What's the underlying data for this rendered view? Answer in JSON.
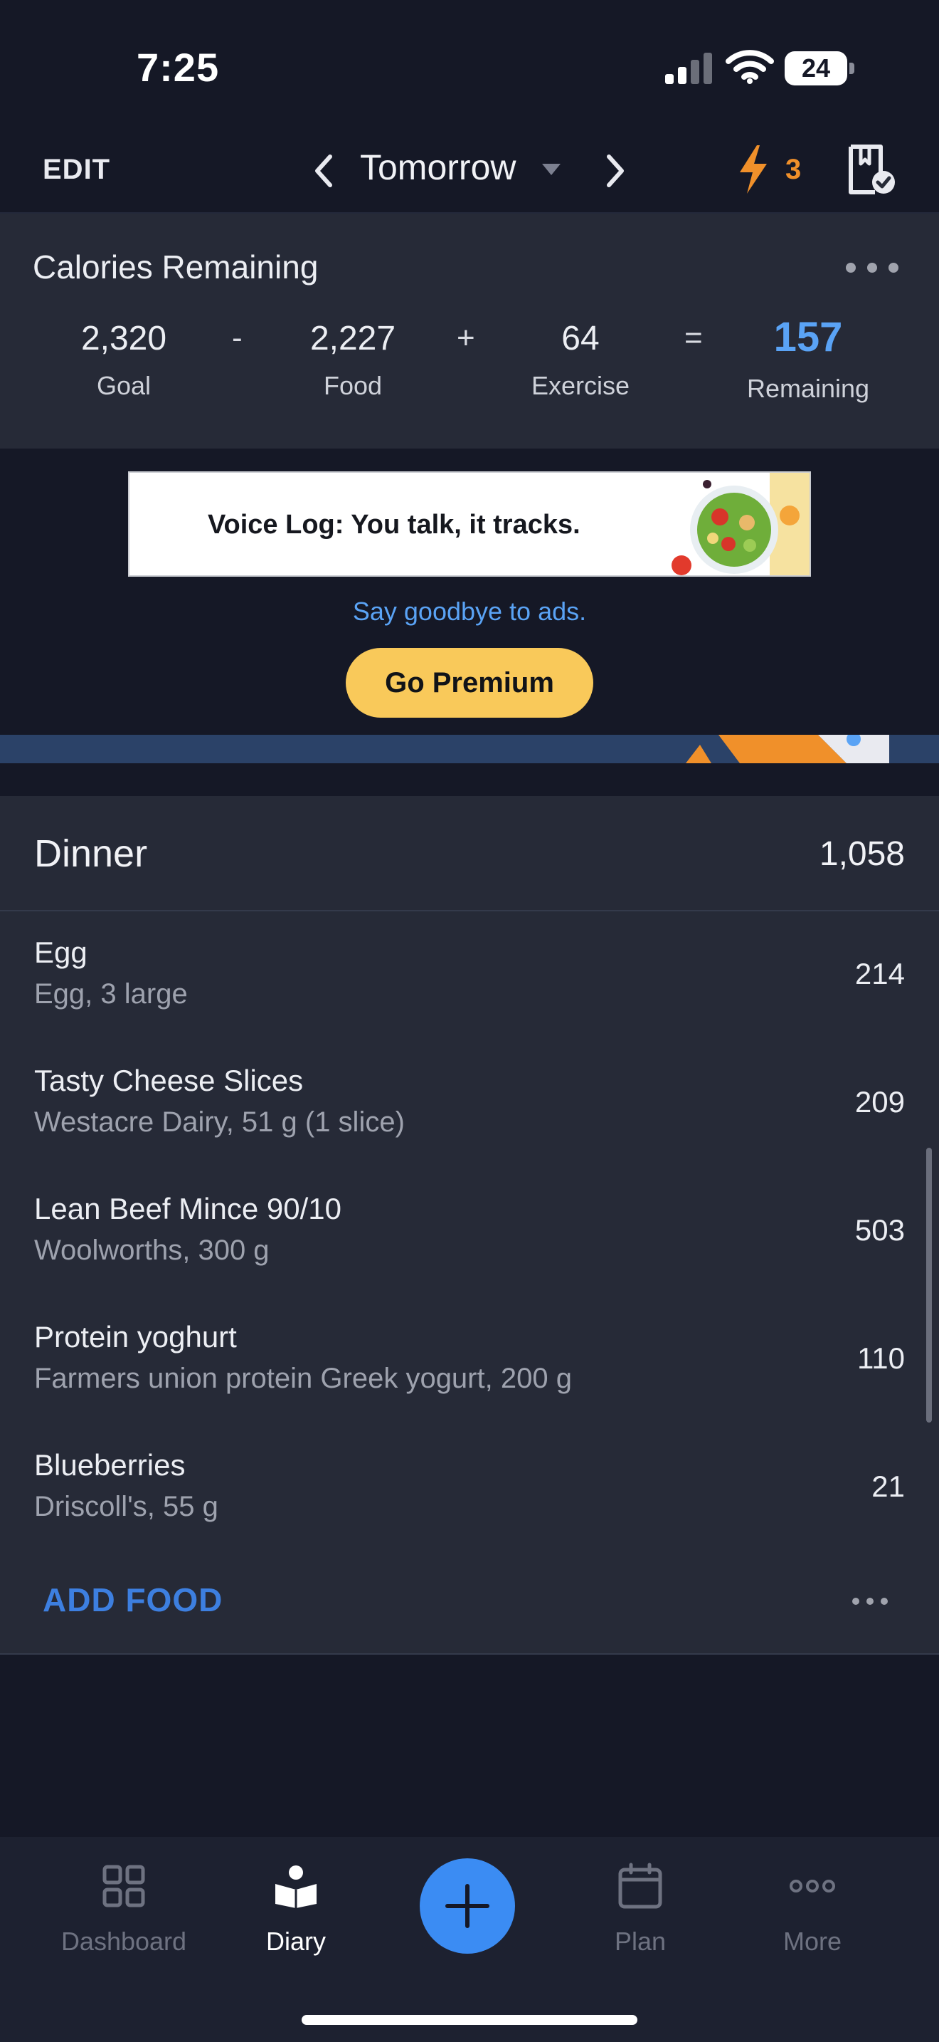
{
  "status_bar": {
    "time": "7:25",
    "battery": "24",
    "icons": [
      "cellular-signal-icon",
      "wifi-icon",
      "battery-icon"
    ]
  },
  "header": {
    "edit_label": "EDIT",
    "date_label": "Tomorrow",
    "streak_count": "3",
    "colors": {
      "streak": "#f0902a"
    }
  },
  "calories": {
    "title": "Calories Remaining",
    "goal": {
      "value": "2,320",
      "label": "Goal"
    },
    "food": {
      "value": "2,227",
      "label": "Food"
    },
    "exercise": {
      "value": "64",
      "label": "Exercise"
    },
    "remaining": {
      "value": "157",
      "label": "Remaining"
    },
    "operators": {
      "minus": "-",
      "plus": "+",
      "equals": "="
    },
    "colors": {
      "remaining": "#5aa3f5"
    }
  },
  "ad": {
    "banner_text": "Voice Log: You talk, it tracks.",
    "subtext": "Say goodbye to ads.",
    "premium_label": "Go Premium",
    "colors": {
      "premium": "#f9c95a",
      "link": "#5aa3f5"
    }
  },
  "meal": {
    "name": "Dinner",
    "total": "1,058",
    "items": [
      {
        "name": "Egg",
        "desc": "Egg, 3 large",
        "cal": "214"
      },
      {
        "name": "Tasty Cheese Slices",
        "desc": "Westacre Dairy, 51 g (1 slice)",
        "cal": "209"
      },
      {
        "name": "Lean Beef Mince 90/10",
        "desc": "Woolworths, 300 g",
        "cal": "503"
      },
      {
        "name": "Protein yoghurt",
        "desc": "Farmers union protein Greek yogurt, 200 g",
        "cal": "110"
      },
      {
        "name": "Blueberries",
        "desc": "Driscoll's, 55 g",
        "cal": "21"
      }
    ],
    "add_food_label": "ADD FOOD",
    "colors": {
      "add_food": "#3d7fe0"
    }
  },
  "tabs": [
    {
      "label": "Dashboard",
      "icon": "dashboard-grid-icon",
      "active": false
    },
    {
      "label": "Diary",
      "icon": "diary-book-icon",
      "active": true
    },
    {
      "label": "Plan",
      "icon": "calendar-icon",
      "active": false
    },
    {
      "label": "More",
      "icon": "more-dots-icon",
      "active": false
    }
  ],
  "fab_icon": "plus-icon"
}
